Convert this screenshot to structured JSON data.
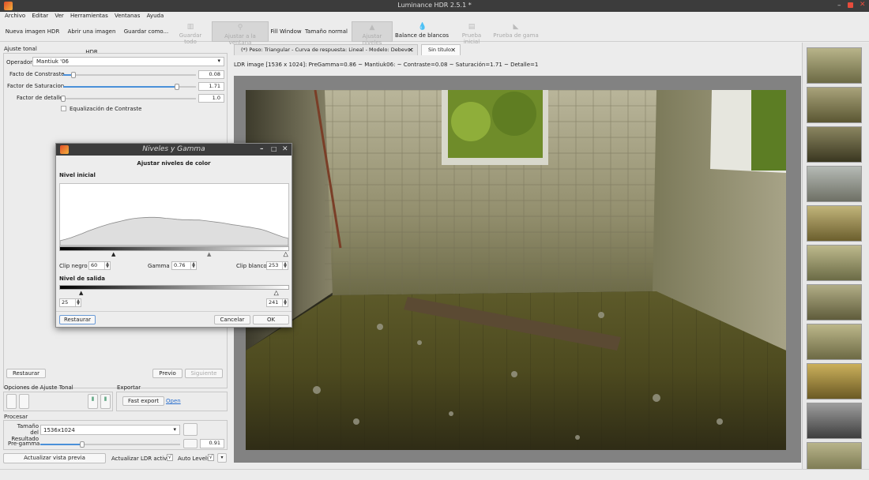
{
  "window": {
    "title": "Luminance HDR 2.5.1 *"
  },
  "menu": [
    "Archivo",
    "Editar",
    "Ver",
    "Herramientas",
    "Ventanas",
    "Ayuda"
  ],
  "toolbar": {
    "new_hdr": "Nueva imagen HDR",
    "open_image": "Abrir una imagen HDR",
    "save_as": "Guardar como...",
    "save_all": "Guardar todo",
    "fit_window": "Ajustar a la ventana",
    "fill_window": "Fill Window",
    "normal_size": "Tamaño normal",
    "adjust_levels": "Ajustar niveles",
    "white_balance": "Balance de blancos",
    "soft_proofing": "Prueba inicial",
    "gamut_check": "Prueba de gama"
  },
  "left_panel": {
    "header": "Ajuste tonal",
    "operator_label": "Operador",
    "operator_value": "Mantiuk '06",
    "contrast_label": "Facto de Constraste",
    "contrast_value": "0.08",
    "contrast_level": 0.08,
    "saturation_label": "Factor de Saturacion",
    "saturation_value": "1.71",
    "saturation_level": 0.855,
    "detail_label": "Factor de detalle",
    "detail_value": "1.0",
    "detail_level": 0.0,
    "contrast_eq_label": "Equalización de Contraste",
    "reset_button": "Restaurar",
    "prev_button": "Previo",
    "next_button": "Siguiente",
    "options_header": "Opciones de Ajuste Tonal",
    "export_header": "Exportar",
    "fast_export_button": "Fast export",
    "open_link": "Open",
    "process_header": "Procesar",
    "result_size_label": "Tamaño del Resultado",
    "result_size_value": "1536x1024",
    "pregamma_label": "Pre-gamma",
    "pregamma_value": "0.91",
    "pregamma_level": 0.3,
    "update_preview_button": "Actualizar vista previa",
    "update_ldr_label": "Actualizar LDR activo",
    "update_ldr_check": "√",
    "auto_levels_label": "Auto Levels",
    "auto_levels_check": "√"
  },
  "tabs": [
    {
      "label": "(*) Peso: Triangular - Curva de respuesta: Lineal - Modelo: Debevoc",
      "close": "✕"
    },
    {
      "label": "Sin título",
      "close": "✕"
    }
  ],
  "info_line": "LDR image [1536 x 1024]: PreGamma=0.86 ~ Mantiuk06: ~ Contraste=0.08 ~ Saturación=1.71 ~ Detalle=1",
  "dialog": {
    "title": "Niveles y Gamma",
    "heading": "Ajustar niveles de color",
    "input_level_label": "Nivel inicial",
    "clip_black_label": "Clip negro",
    "clip_black_value": "60",
    "gamma_label": "Gamma",
    "gamma_value": "0.76",
    "clip_white_label": "Clip blanco",
    "clip_white_value": "253",
    "output_level_label": "Nivel de salida",
    "out_black_value": "25",
    "out_white_value": "241",
    "restore_button": "Restaurar",
    "cancel_button": "Cancelar",
    "ok_button": "OK",
    "histogram": [
      0.05,
      0.09,
      0.14,
      0.2,
      0.26,
      0.33,
      0.39,
      0.45,
      0.5,
      0.55,
      0.59,
      0.63,
      0.67,
      0.7,
      0.72,
      0.73,
      0.74,
      0.74,
      0.73,
      0.71,
      0.7,
      0.68,
      0.67,
      0.67,
      0.66,
      0.66,
      0.64,
      0.62,
      0.6,
      0.58,
      0.55,
      0.52,
      0.5,
      0.47,
      0.45,
      0.42,
      0.39,
      0.34,
      0.28,
      0.22,
      0.16,
      0.12
    ]
  },
  "icons": {
    "app": "luminance-app-icon",
    "minimize": "–",
    "maximize": "□",
    "close": "✕"
  }
}
